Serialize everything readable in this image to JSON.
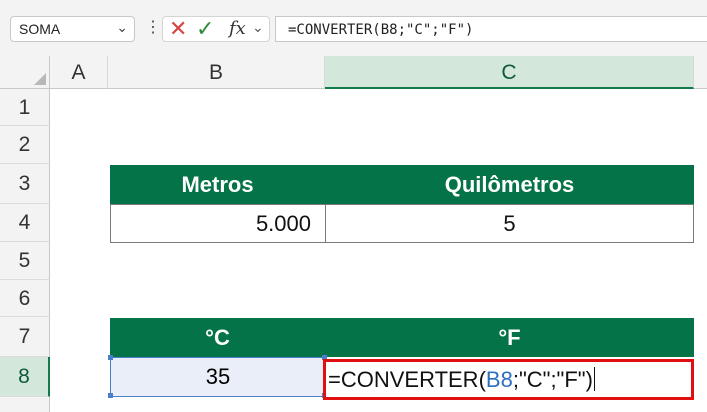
{
  "formula_bar": {
    "name_box": "SOMA",
    "formula": "=CONVERTER(B8;\"C\";\"F\")",
    "fx_label": "fx"
  },
  "columns": [
    "A",
    "B",
    "C"
  ],
  "rows": [
    "1",
    "2",
    "3",
    "4",
    "5",
    "6",
    "7",
    "8"
  ],
  "table1": {
    "header_b": "Metros",
    "header_c": "Quilômetros",
    "value_b": "5.000",
    "value_c": "5"
  },
  "table2": {
    "header_b": "°C",
    "header_c": "°F",
    "value_b": "35",
    "edit_prefix": "=CONVERTER(",
    "edit_ref": "B8",
    "edit_suffix": ";\"C\";\"F\")"
  },
  "colors": {
    "header_green": "#047347",
    "selected_header": "#d3e8da",
    "highlight_red": "#e01010",
    "reference_blue": "#2f6fbf"
  }
}
